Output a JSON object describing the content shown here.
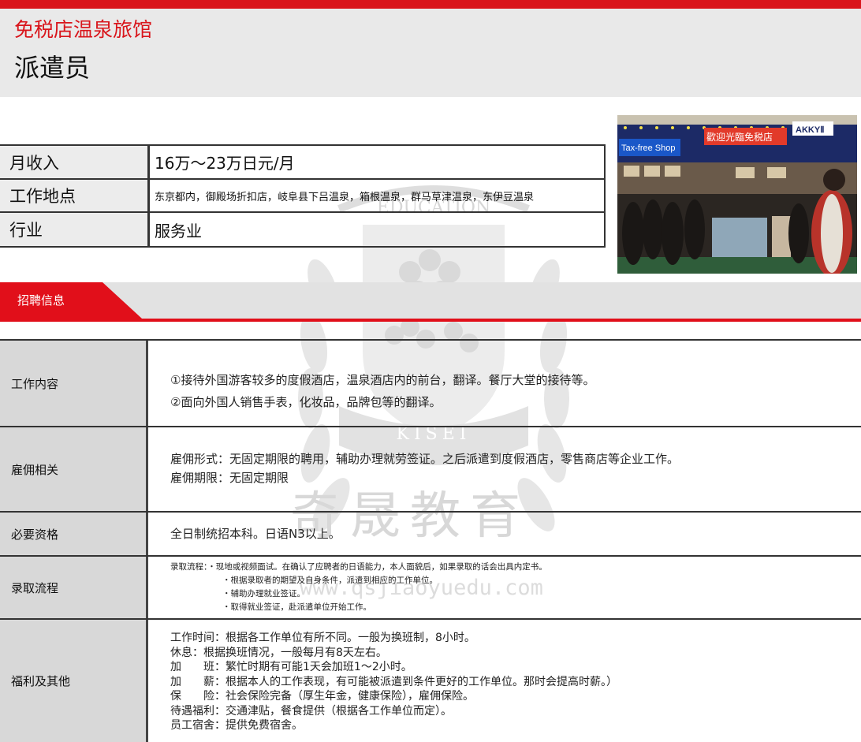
{
  "header": {
    "subtitle": "免税店温泉旅馆",
    "title": "派遣员"
  },
  "summary": [
    {
      "label": "月收入",
      "value": "16万～23万日元/月"
    },
    {
      "label": "工作地点",
      "value": "东京都内，御殿场折扣店，岐阜县下吕温泉，箱根温泉，群马草津温泉，东伊豆温泉"
    },
    {
      "label": "行业",
      "value": "服务业"
    }
  ],
  "photo": {
    "sign_left": "Tax-free Shop",
    "sign_mid": "歡迎光臨免税店",
    "sign_right": "AKKYⅡ"
  },
  "section": {
    "label": "招聘信息"
  },
  "details": {
    "job_content": {
      "label": "工作内容",
      "lines": [
        "①接待外国游客较多的度假酒店，温泉酒店内的前台，翻译。餐厅大堂的接待等。",
        "②面向外国人销售手表，化妆品，品牌包等的翻译。"
      ]
    },
    "employment": {
      "label": "雇佣相关",
      "lines": [
        "雇佣形式：无固定期限的聘用，辅助办理就劳签证。之后派遣到度假酒店，零售商店等企业工作。",
        "雇佣期限：无固定期限"
      ]
    },
    "requirements": {
      "label": "必要资格",
      "lines": [
        "全日制统招本科。日语N3以上。"
      ]
    },
    "hiring_process": {
      "label": "录取流程",
      "lines": [
        "录取流程：・现地或视频面试。在确认了应聘者的日语能力，本人面貌后，如果录取的话会出具内定书。",
        "・根据录取者的期望及自身条件，派遣到相应的工作单位。",
        "・辅助办理就业签证。",
        "・取得就业签证，赴派遣单位开始工作。"
      ]
    },
    "benefits": {
      "label": "福利及其他",
      "lines": [
        "工作时间：根据各工作单位有所不同。一般为换班制，8小时。",
        "休息：根据换班情况，一般每月有8天左右。",
        "加　　班：繁忙时期有可能1天会加班1～2小时。",
        "加　　薪：根据本人的工作表现，有可能被派遣到条件更好的工作单位。那时会提高时薪。）",
        "保　　险：社会保险完备（厚生年金，健康保险），雇佣保险。",
        "待遇福利：交通津贴，餐食提供（根据各工作单位而定）。",
        "员工宿舍：提供免费宿舍。"
      ]
    }
  },
  "watermark": {
    "arc_text": "EDUCATION",
    "band_text": "KISEI",
    "cn_text": "奇晟教育",
    "url": "www.qsjiaoyuedu.com"
  },
  "colors": {
    "accent_red": "#d9151b",
    "header_gray": "#e9e9e9",
    "label_gray": "#d8d8d8"
  }
}
